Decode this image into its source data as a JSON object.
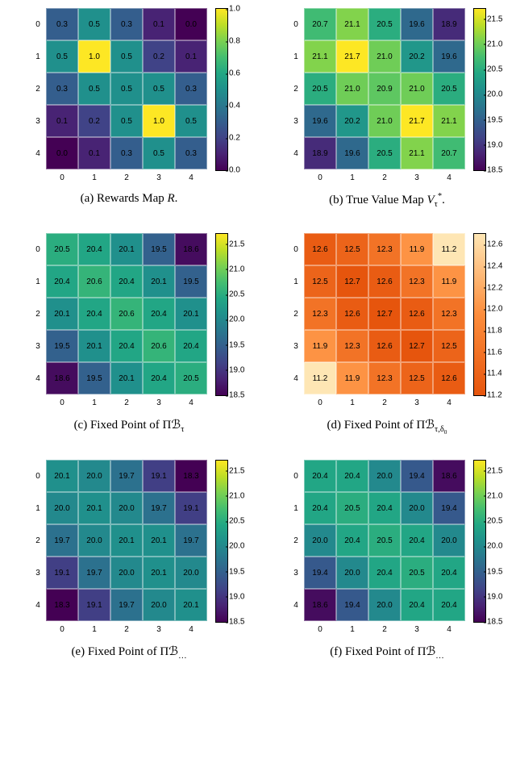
{
  "chart_data": [
    {
      "id": "a",
      "type": "heatmap",
      "caption_prefix": "(a) ",
      "caption_html": "Rewards Map <i>R</i>.",
      "xticks": [
        "0",
        "1",
        "2",
        "3",
        "4"
      ],
      "yticks": [
        "0",
        "1",
        "2",
        "3",
        "4"
      ],
      "values": [
        [
          0.3,
          0.5,
          0.3,
          0.1,
          0.0
        ],
        [
          0.5,
          1.0,
          0.5,
          0.2,
          0.1
        ],
        [
          0.3,
          0.5,
          0.5,
          0.5,
          0.3
        ],
        [
          0.1,
          0.2,
          0.5,
          1.0,
          0.5
        ],
        [
          0.0,
          0.1,
          0.3,
          0.5,
          0.3
        ]
      ],
      "vmin": 0.0,
      "vmax": 1.0,
      "cmap": "viridis",
      "fmt": 1,
      "cbar_ticks": [
        0.0,
        0.2,
        0.4,
        0.6,
        0.8,
        1.0
      ]
    },
    {
      "id": "b",
      "type": "heatmap",
      "caption_prefix": "(b) ",
      "caption_html": "True Value Map <i>V</i><sub>&tau;</sub><sup>*</sup>.",
      "xticks": [
        "0",
        "1",
        "2",
        "3",
        "4"
      ],
      "yticks": [
        "0",
        "1",
        "2",
        "3",
        "4"
      ],
      "values": [
        [
          20.7,
          21.1,
          20.5,
          19.6,
          18.9
        ],
        [
          21.1,
          21.7,
          21.0,
          20.2,
          19.6
        ],
        [
          20.5,
          21.0,
          20.9,
          21.0,
          20.5
        ],
        [
          19.6,
          20.2,
          21.0,
          21.7,
          21.1
        ],
        [
          18.9,
          19.6,
          20.5,
          21.1,
          20.7
        ]
      ],
      "vmin": 18.5,
      "vmax": 21.7,
      "cmap": "viridis",
      "fmt": 1,
      "cbar_ticks": [
        18.5,
        19.0,
        19.5,
        20.0,
        20.5,
        21.0,
        21.5
      ]
    },
    {
      "id": "c",
      "type": "heatmap",
      "caption_prefix": "(c) ",
      "caption_html": "Fixed Point of &Pi;<span style='font-family:serif'>ℬ</span><sub>&tau;</sub>",
      "xticks": [
        "0",
        "1",
        "2",
        "3",
        "4"
      ],
      "yticks": [
        "0",
        "1",
        "2",
        "3",
        "4"
      ],
      "values": [
        [
          20.5,
          20.4,
          20.1,
          19.5,
          18.6
        ],
        [
          20.4,
          20.6,
          20.4,
          20.1,
          19.5
        ],
        [
          20.1,
          20.4,
          20.6,
          20.4,
          20.1
        ],
        [
          19.5,
          20.1,
          20.4,
          20.6,
          20.4
        ],
        [
          18.6,
          19.5,
          20.1,
          20.4,
          20.5
        ]
      ],
      "vmin": 18.5,
      "vmax": 21.7,
      "cmap": "viridis",
      "fmt": 1,
      "cbar_ticks": [
        18.5,
        19.0,
        19.5,
        20.0,
        20.5,
        21.0,
        21.5
      ]
    },
    {
      "id": "d",
      "type": "heatmap",
      "caption_prefix": "(d) ",
      "caption_html": "Fixed Point of &Pi;<span style='font-family:serif'>ℬ</span><sub>&tau;,&delta;<sub>0</sub></sub>",
      "xticks": [
        "0",
        "1",
        "2",
        "3",
        "4"
      ],
      "yticks": [
        "0",
        "1",
        "2",
        "3",
        "4"
      ],
      "values": [
        [
          12.6,
          12.5,
          12.3,
          11.9,
          11.2
        ],
        [
          12.5,
          12.7,
          12.6,
          12.3,
          11.9
        ],
        [
          12.3,
          12.6,
          12.7,
          12.6,
          12.3
        ],
        [
          11.9,
          12.3,
          12.6,
          12.7,
          12.5
        ],
        [
          11.2,
          11.9,
          12.3,
          12.5,
          12.6
        ]
      ],
      "vmin": 11.2,
      "vmax": 12.7,
      "cmap": "oranges_r",
      "fmt": 1,
      "cbar_ticks": [
        11.2,
        11.4,
        11.6,
        11.8,
        12.0,
        12.2,
        12.4,
        12.6
      ]
    },
    {
      "id": "e",
      "type": "heatmap",
      "caption_prefix": "(e) ",
      "caption_html": "Fixed Point of &Pi;<span style='font-family:serif'>ℬ</span><sub>…</sub>",
      "xticks": [
        "0",
        "1",
        "2",
        "3",
        "4"
      ],
      "yticks": [
        "0",
        "1",
        "2",
        "3",
        "4"
      ],
      "values": [
        [
          20.1,
          20.0,
          19.7,
          19.1,
          18.3
        ],
        [
          20.0,
          20.1,
          20.0,
          19.7,
          19.1
        ],
        [
          19.7,
          20.0,
          20.1,
          20.1,
          19.7
        ],
        [
          19.1,
          19.7,
          20.0,
          20.1,
          20.0
        ],
        [
          18.3,
          19.1,
          19.7,
          20.0,
          20.1
        ]
      ],
      "vmin": 18.5,
      "vmax": 21.7,
      "cmap": "viridis",
      "fmt": 1,
      "cbar_ticks": [
        18.5,
        19.0,
        19.5,
        20.0,
        20.5,
        21.0,
        21.5
      ]
    },
    {
      "id": "f",
      "type": "heatmap",
      "caption_prefix": "(f) ",
      "caption_html": "Fixed Point of &Pi;<span style='font-family:serif'>ℬ</span><sub>…</sub>",
      "xticks": [
        "0",
        "1",
        "2",
        "3",
        "4"
      ],
      "yticks": [
        "0",
        "1",
        "2",
        "3",
        "4"
      ],
      "values": [
        [
          20.4,
          20.4,
          20.0,
          19.4,
          18.6
        ],
        [
          20.4,
          20.5,
          20.4,
          20.0,
          19.4
        ],
        [
          20.0,
          20.4,
          20.5,
          20.4,
          20.0
        ],
        [
          19.4,
          20.0,
          20.4,
          20.5,
          20.4
        ],
        [
          18.6,
          19.4,
          20.0,
          20.4,
          20.4
        ]
      ],
      "vmin": 18.5,
      "vmax": 21.7,
      "cmap": "viridis",
      "fmt": 1,
      "cbar_ticks": [
        18.5,
        19.0,
        19.5,
        20.0,
        20.5,
        21.0,
        21.5
      ]
    }
  ]
}
